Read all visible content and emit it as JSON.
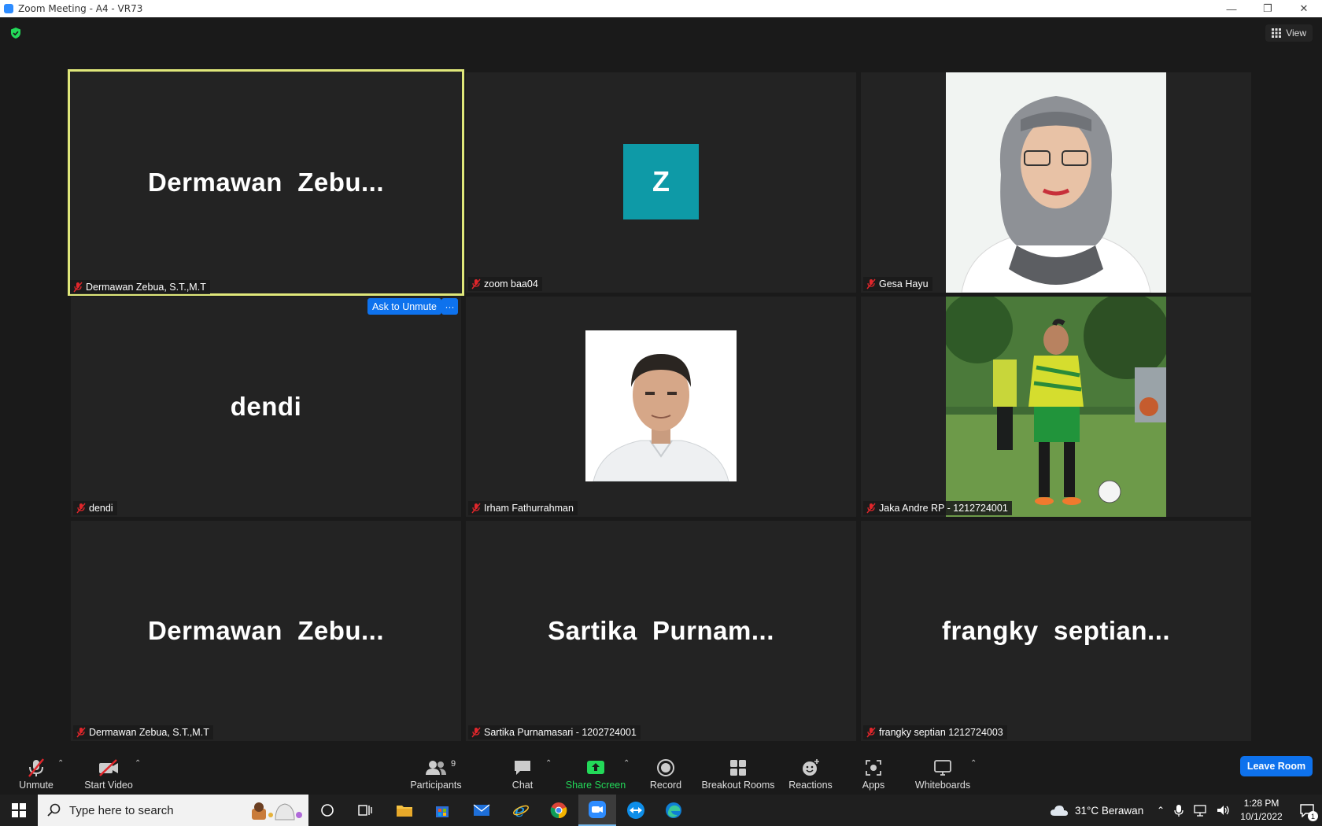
{
  "window": {
    "title": "Zoom Meeting - A4 - VR73"
  },
  "meeting": {
    "view_label": "View"
  },
  "tiles": [
    {
      "display": "Dermawan  Zebu...",
      "name": "Dermawan Zebua, S.T.,M.T"
    },
    {
      "display": "Z",
      "name": "zoom baa04"
    },
    {
      "display": "",
      "name": "Gesa Hayu"
    },
    {
      "display": "dendi",
      "name": "dendi"
    },
    {
      "display": "",
      "name": "Irham Fathurrahman"
    },
    {
      "display": "",
      "name": "Jaka Andre RP - 1212724001"
    },
    {
      "display": "Dermawan  Zebu...",
      "name": "Dermawan Zebua, S.T.,M.T"
    },
    {
      "display": "Sartika  Purnam...",
      "name": "Sartika Purnamasari - 1202724001"
    },
    {
      "display": "frangky  septian...",
      "name": "frangky septian 1212724003"
    }
  ],
  "tile_actions": {
    "ask_to_unmute": "Ask to Unmute",
    "more": "···"
  },
  "toolbar": {
    "unmute": "Unmute",
    "start_video": "Start Video",
    "participants": "Participants",
    "participants_count": "9",
    "chat": "Chat",
    "share_screen": "Share Screen",
    "record": "Record",
    "breakout_rooms": "Breakout Rooms",
    "reactions": "Reactions",
    "apps": "Apps",
    "whiteboards": "Whiteboards",
    "leave_room": "Leave Room"
  },
  "taskbar": {
    "search_placeholder": "Type here to search",
    "weather": "31°C  Berawan",
    "time": "1:28 PM",
    "date": "10/1/2022",
    "notifications": "1"
  },
  "colors": {
    "accent": "#0e72ed",
    "active_speaker": "#dfe77a",
    "share_green": "#23d959",
    "avatar_z": "#0e9aa7"
  }
}
